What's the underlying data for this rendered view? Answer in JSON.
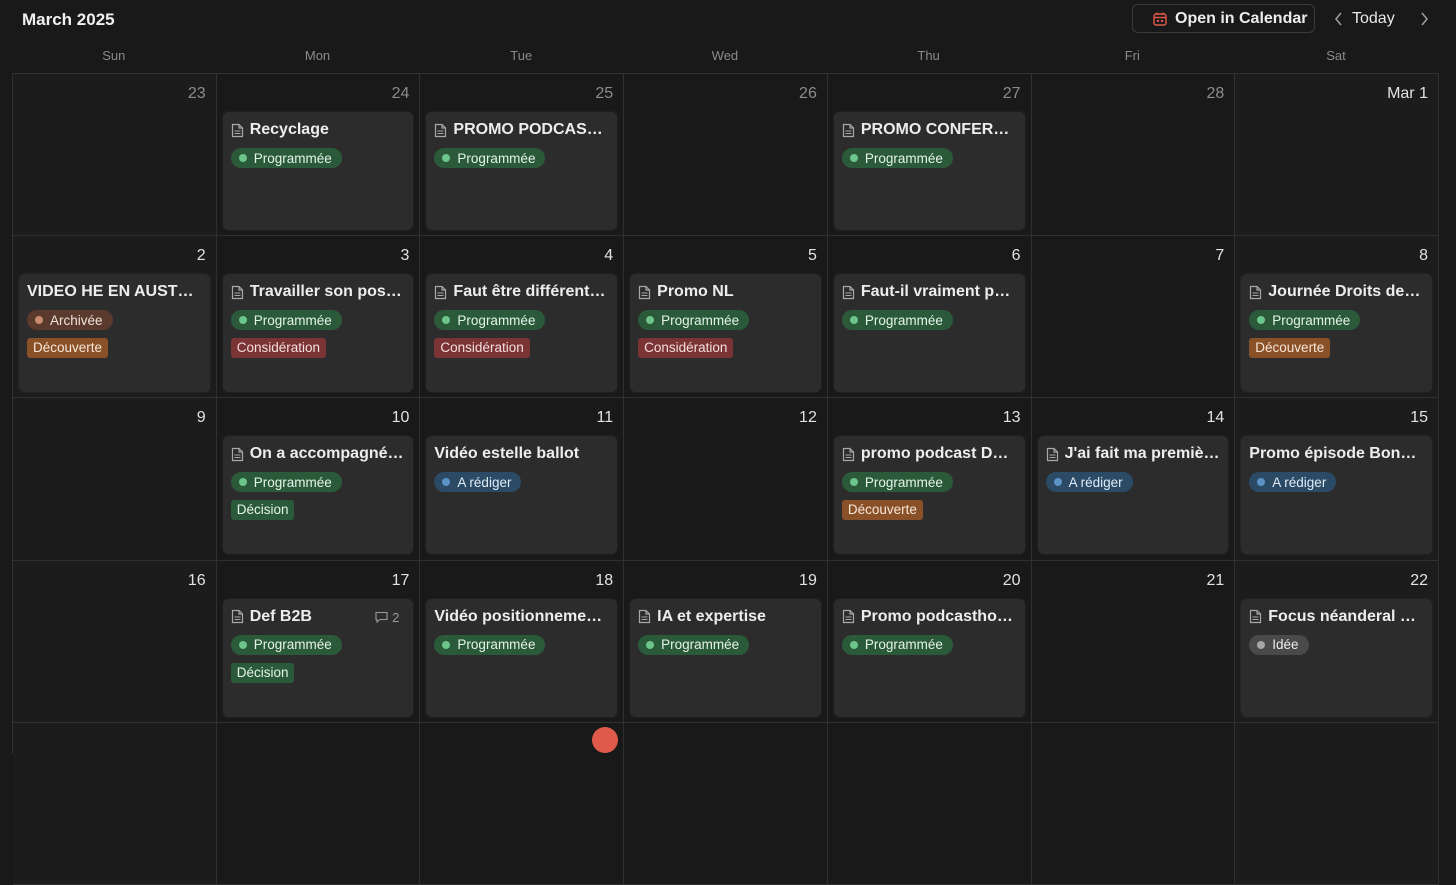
{
  "header": {
    "month_title": "March 2025",
    "open_calendar_label": "Open in Calendar",
    "today_label": "Today"
  },
  "weekdays": [
    "Sun",
    "Mon",
    "Tue",
    "Wed",
    "Thu",
    "Fri",
    "Sat"
  ],
  "colors": {
    "background": "#191919",
    "card": "#2c2c2c",
    "status_programmee": "#2b5a3a",
    "status_a_rediger": "#2a4a66",
    "status_archivee": "#5a3a2c",
    "status_idee": "#4a4a4a",
    "tag_decouverte": "#8a5128",
    "tag_consideration": "#7a3436",
    "tag_decision": "#2b5a3a",
    "today_marker": "#e05a4b"
  },
  "weeks": [
    [
      {
        "day": "23",
        "muted": true,
        "events": []
      },
      {
        "day": "24",
        "muted": true,
        "events": [
          {
            "title": "Recyclage",
            "doc": true,
            "status": "Programmée",
            "status_color": "green"
          }
        ]
      },
      {
        "day": "25",
        "muted": true,
        "events": [
          {
            "title": "PROMO PODCAST …",
            "doc": true,
            "status": "Programmée",
            "status_color": "green"
          }
        ]
      },
      {
        "day": "26",
        "muted": true,
        "events": []
      },
      {
        "day": "27",
        "muted": true,
        "events": [
          {
            "title": "PROMO CONFERE…",
            "doc": true,
            "status": "Programmée",
            "status_color": "green"
          }
        ]
      },
      {
        "day": "28",
        "muted": true,
        "events": []
      },
      {
        "day": "Mar 1",
        "muted": false,
        "events": []
      }
    ],
    [
      {
        "day": "2",
        "events": [
          {
            "title": "VIDEO HE EN AUSTRA…",
            "doc": false,
            "status": "Archivée",
            "status_color": "brown",
            "tag": "Découverte",
            "tag_color": "orange"
          }
        ]
      },
      {
        "day": "3",
        "events": [
          {
            "title": "Travailler son positi…",
            "doc": true,
            "status": "Programmée",
            "status_color": "green",
            "tag": "Considération",
            "tag_color": "red"
          }
        ]
      },
      {
        "day": "4",
        "events": [
          {
            "title": "Faut être différent\"…",
            "doc": true,
            "status": "Programmée",
            "status_color": "green",
            "tag": "Considération",
            "tag_color": "red"
          }
        ]
      },
      {
        "day": "5",
        "events": [
          {
            "title": "Promo NL",
            "doc": true,
            "status": "Programmée",
            "status_color": "green",
            "tag": "Considération",
            "tag_color": "red"
          }
        ]
      },
      {
        "day": "6",
        "events": [
          {
            "title": "Faut-il vraiment par…",
            "doc": true,
            "status": "Programmée",
            "status_color": "green"
          }
        ]
      },
      {
        "day": "7",
        "events": []
      },
      {
        "day": "8",
        "events": [
          {
            "title": "Journée Droits des …",
            "doc": true,
            "status": "Programmée",
            "status_color": "green",
            "tag": "Découverte",
            "tag_color": "orange"
          }
        ]
      }
    ],
    [
      {
        "day": "9",
        "events": []
      },
      {
        "day": "10",
        "events": [
          {
            "title": "On a accompagné …",
            "doc": true,
            "status": "Programmée",
            "status_color": "green",
            "tag": "Décision",
            "tag_color": "teal"
          }
        ]
      },
      {
        "day": "11",
        "events": [
          {
            "title": "Vidéo estelle ballot",
            "doc": false,
            "status": "A rédiger",
            "status_color": "blue"
          }
        ]
      },
      {
        "day": "12",
        "events": []
      },
      {
        "day": "13",
        "events": [
          {
            "title": "promo podcast Do…",
            "doc": true,
            "status": "Programmée",
            "status_color": "green",
            "tag": "Découverte",
            "tag_color": "orange"
          }
        ]
      },
      {
        "day": "14",
        "events": [
          {
            "title": "J'ai fait ma premièr…",
            "doc": true,
            "status": "A rédiger",
            "status_color": "blue"
          }
        ]
      },
      {
        "day": "15",
        "events": [
          {
            "title": "Promo épisode Bonne…",
            "doc": false,
            "status": "A rédiger",
            "status_color": "blue"
          }
        ]
      }
    ],
    [
      {
        "day": "16",
        "events": []
      },
      {
        "day": "17",
        "events": [
          {
            "title": "Def B2B",
            "doc": true,
            "status": "Programmée",
            "status_color": "green",
            "tag": "Décision",
            "tag_color": "teal",
            "comments": "2"
          }
        ]
      },
      {
        "day": "18",
        "events": [
          {
            "title": "Vidéo positionnement…",
            "doc": false,
            "status": "Programmée",
            "status_color": "green"
          }
        ]
      },
      {
        "day": "19",
        "events": [
          {
            "title": "IA et expertise",
            "doc": true,
            "status": "Programmée",
            "status_color": "green"
          }
        ]
      },
      {
        "day": "20",
        "events": [
          {
            "title": "Promo podcasthon…",
            "doc": true,
            "status": "Programmée",
            "status_color": "green"
          }
        ]
      },
      {
        "day": "21",
        "events": []
      },
      {
        "day": "22",
        "events": [
          {
            "title": "Focus néanderal vs …",
            "doc": true,
            "status": "Idée",
            "status_color": "grey"
          }
        ]
      }
    ],
    [
      {
        "day": "",
        "events": []
      },
      {
        "day": "",
        "events": []
      },
      {
        "day": "",
        "events": []
      },
      {
        "day": "",
        "events": []
      },
      {
        "day": "",
        "events": []
      },
      {
        "day": "",
        "events": []
      },
      {
        "day": "",
        "events": []
      }
    ]
  ]
}
